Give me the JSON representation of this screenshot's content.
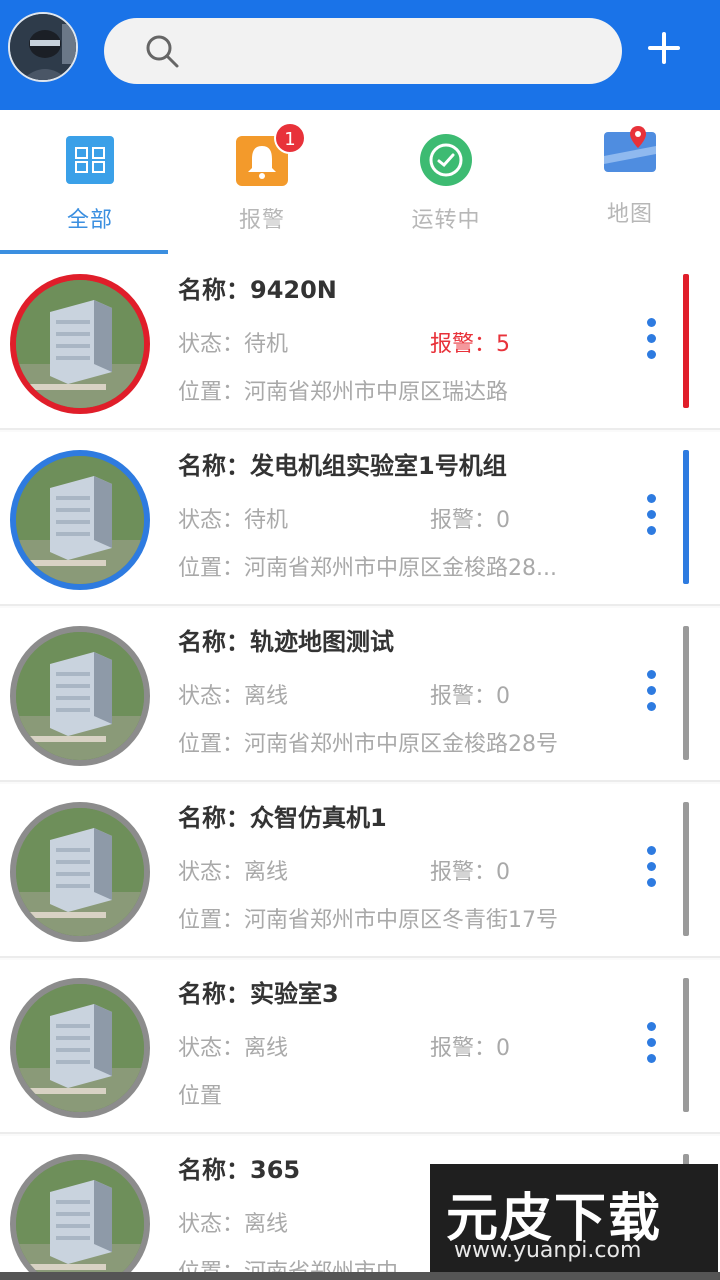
{
  "header": {
    "avatar_icon": "user-avatar",
    "search_icon": "search-icon",
    "search_placeholder": "",
    "add_icon": "plus-icon",
    "bg_color": "#1a73e8"
  },
  "tabs": [
    {
      "label": "全部",
      "icon": "grid-icon",
      "active": true
    },
    {
      "label": "报警",
      "icon": "bell-icon",
      "badge": "1"
    },
    {
      "label": "运转中",
      "icon": "running-icon"
    },
    {
      "label": "地图",
      "icon": "map-icon"
    }
  ],
  "devices": [
    {
      "name": "名称：9420N",
      "status": "状态：待机",
      "alarm": "报警：5",
      "location": "位置：河南省郑州市中原区瑞达路",
      "accent": "red"
    },
    {
      "name": "名称：发电机组实验室1号机组",
      "status": "状态：待机",
      "alarm": "报警：0",
      "location": "位置：河南省郑州市中原区金梭路28...",
      "accent": "blue"
    },
    {
      "name": "名称：轨迹地图测试",
      "status": "状态：离线",
      "alarm": "报警：0",
      "location": "位置：河南省郑州市中原区金梭路28号",
      "accent": "gray"
    },
    {
      "name": "名称：众智仿真机1",
      "status": "状态：离线",
      "alarm": "报警：0",
      "location": "位置：河南省郑州市中原区冬青街17号",
      "accent": "gray"
    },
    {
      "name": "名称：实验室3",
      "status": "状态：离线",
      "alarm": "报警：0",
      "location": "位置",
      "accent": "gray"
    },
    {
      "name": "名称：365",
      "status": "状态：离线",
      "alarm": "",
      "location": "位置：河南省郑州市中",
      "accent": "gray"
    }
  ],
  "watermark": {
    "title": "元皮下载",
    "url": "www.yuanpi.com"
  }
}
